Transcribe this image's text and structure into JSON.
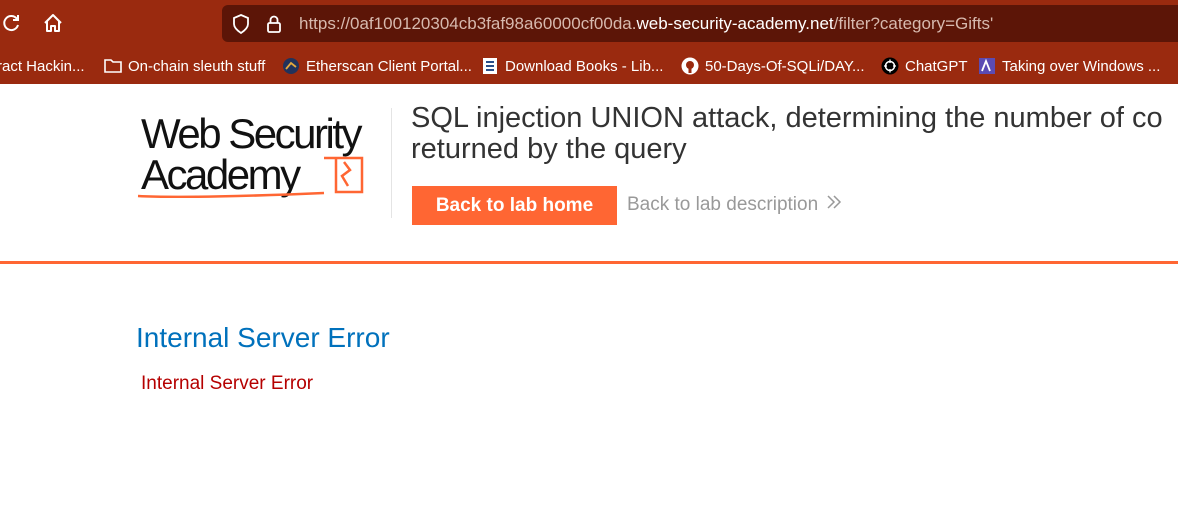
{
  "browser": {
    "url_prefix": "https://0af100120304cb3faf98a60000cf00da.",
    "url_domain": "web-security-academy.net",
    "url_suffix": "/filter?category=Gifts'",
    "bookmarks": [
      {
        "label": "ract Hackin...",
        "icon": "none"
      },
      {
        "label": "On-chain sleuth stuff",
        "icon": "folder-icon"
      },
      {
        "label": "Etherscan Client Portal...",
        "icon": "etherscan-icon"
      },
      {
        "label": "Download Books - Lib...",
        "icon": "book-icon"
      },
      {
        "label": "50-Days-Of-SQLi/DAY...",
        "icon": "github-icon"
      },
      {
        "label": "ChatGPT",
        "icon": "chatgpt-icon"
      },
      {
        "label": "Taking over Windows ...",
        "icon": "site-icon"
      }
    ]
  },
  "header": {
    "logo_line1": "Web Security",
    "logo_line2": "Academy",
    "lab_title_line1": "SQL injection UNION attack, determining the number of co",
    "lab_title_line2": "returned by the query",
    "back_home_label": "Back to lab home",
    "back_description_label": "Back to lab description",
    "accent": "#ff6633"
  },
  "content": {
    "heading": "Internal Server Error",
    "message": "Internal Server Error"
  }
}
